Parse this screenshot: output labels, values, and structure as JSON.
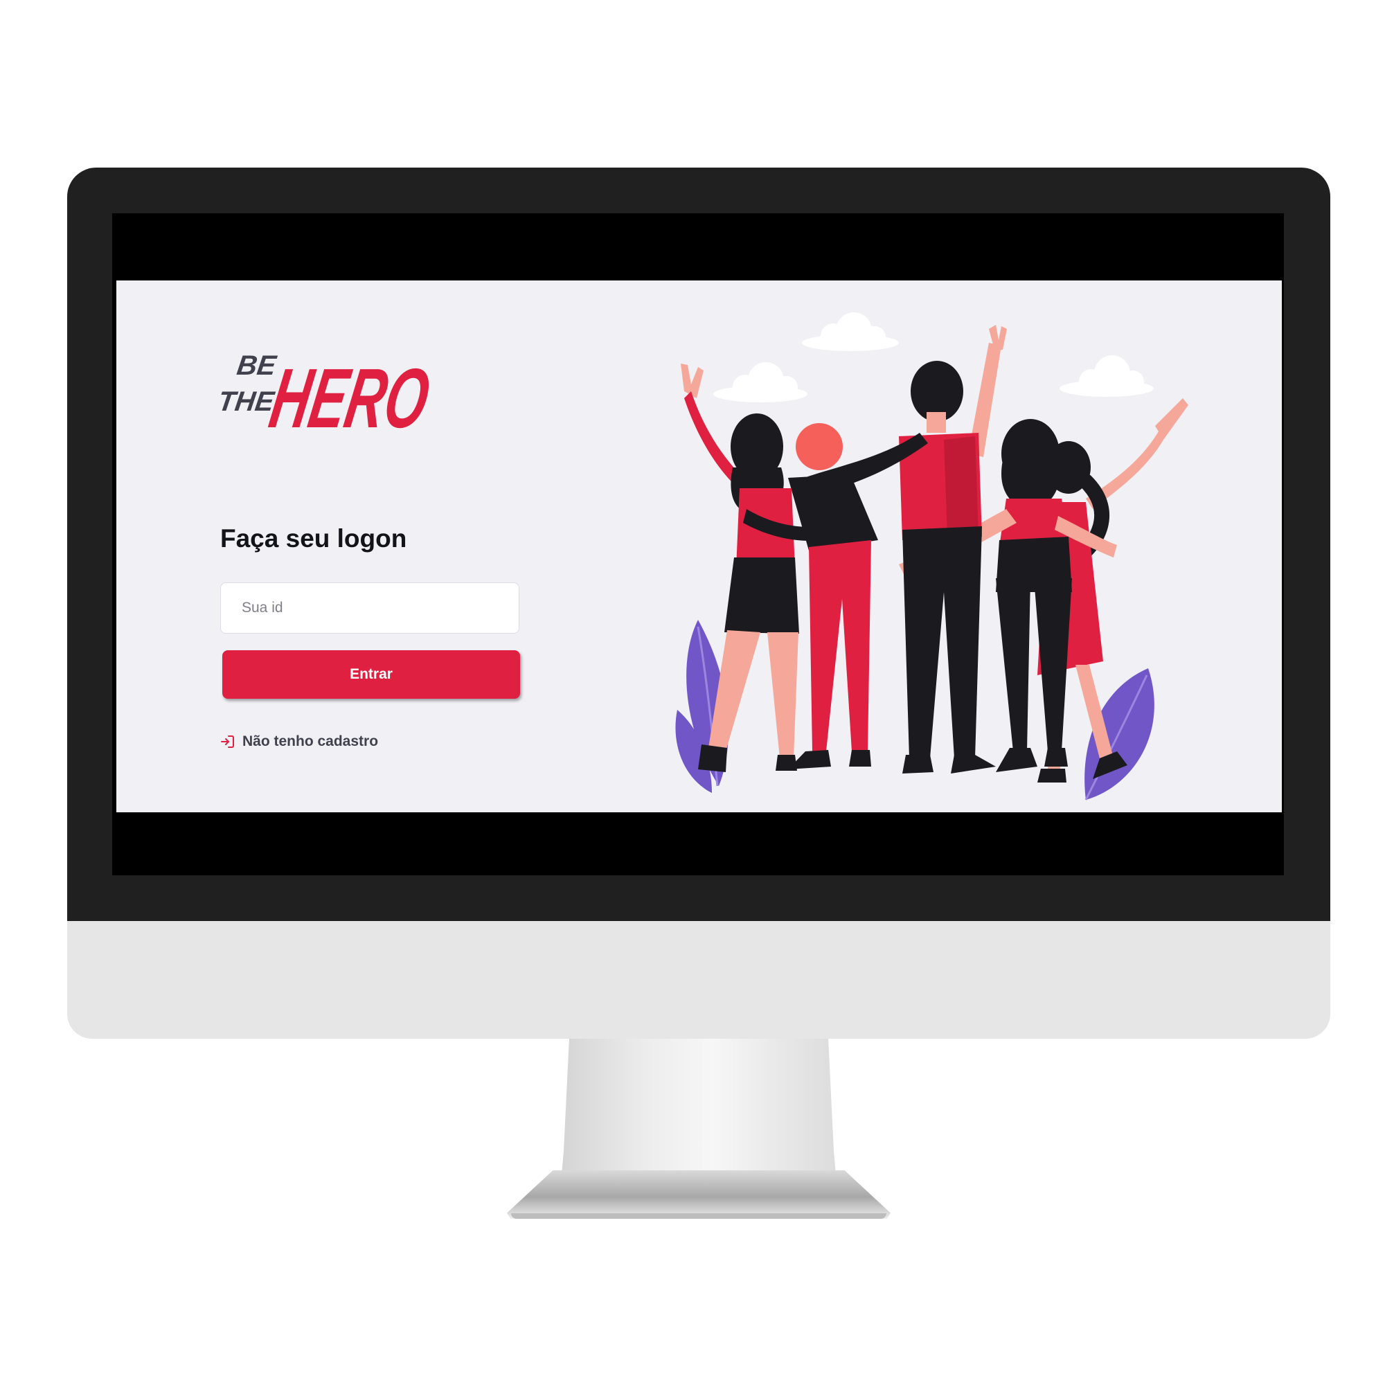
{
  "logo": {
    "line_be": "BE",
    "line_the": "THE",
    "line_hero": "HERO"
  },
  "login": {
    "title": "Faça seu logon",
    "id_input": {
      "placeholder": "Sua id",
      "value": ""
    },
    "submit_label": "Entrar",
    "register_link_label": "Não tenho cadastro",
    "register_icon": "log-in-icon"
  },
  "illustration": {
    "name": "heroes-illustration"
  },
  "colors": {
    "brand_red": "#e02041",
    "background": "#f0f0f5",
    "title_text": "#13131a",
    "body_text": "#41414d",
    "leaf_purple": "#7156c8"
  }
}
